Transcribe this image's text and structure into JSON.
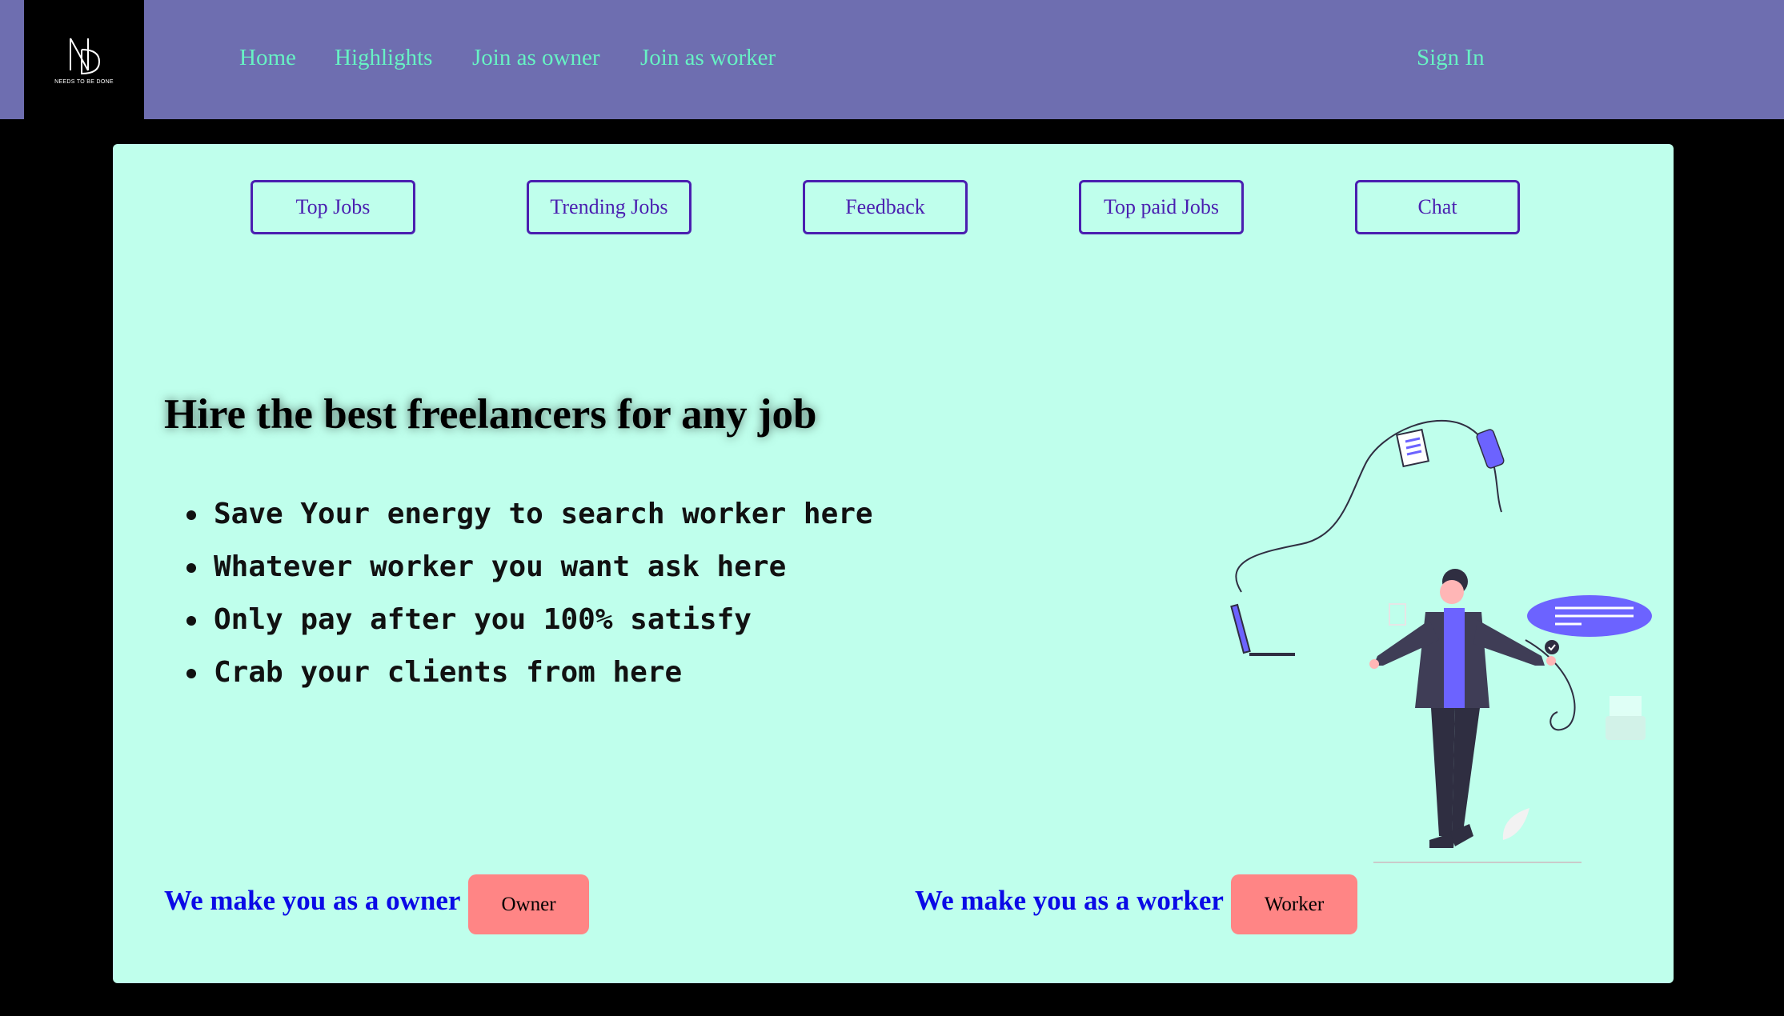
{
  "brand": {
    "logo_tagline": "NEEDS TO BE DONE",
    "logo_icon": "nd-monogram-icon"
  },
  "nav": {
    "links": [
      {
        "label": "Home"
      },
      {
        "label": "Highlights"
      },
      {
        "label": "Join as owner"
      },
      {
        "label": "Join as worker"
      }
    ],
    "sign_in": "Sign In"
  },
  "tabs": [
    {
      "label": "Top Jobs"
    },
    {
      "label": "Trending Jobs"
    },
    {
      "label": "Feedback"
    },
    {
      "label": "Top paid Jobs"
    },
    {
      "label": "Chat"
    }
  ],
  "hero": {
    "title": "Hire the best freelancers for any job",
    "bullets": [
      "Save Your energy to search worker here",
      "Whatever worker you want ask here",
      "Only pay after you 100% satisfy",
      "Crab your clients from here"
    ]
  },
  "cta": {
    "owner_text": "We make you as a owner",
    "owner_button": "Owner",
    "worker_text": "We make you as a worker",
    "worker_button": "Worker"
  },
  "colors": {
    "header_bg": "#6e6eb0",
    "nav_link": "#67f2c4",
    "card_bg": "#bfffec",
    "tab_border": "#4a1fb0",
    "cta_text": "#0a0ae6",
    "cta_button": "#ff8585",
    "illustration_accent": "#6c63ff"
  }
}
